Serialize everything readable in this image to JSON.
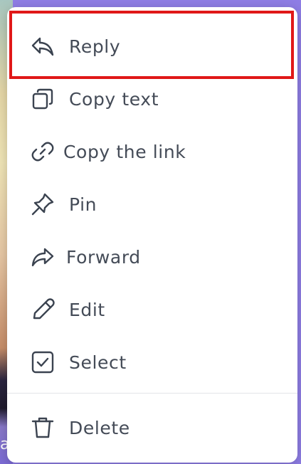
{
  "menu": {
    "items": [
      {
        "label": "Reply",
        "icon": "reply-icon"
      },
      {
        "label": "Copy text",
        "icon": "copy-icon"
      },
      {
        "label": "Copy the link",
        "icon": "link-icon"
      },
      {
        "label": "Pin",
        "icon": "pin-icon"
      },
      {
        "label": "Forward",
        "icon": "forward-icon"
      },
      {
        "label": "Edit",
        "icon": "pencil-icon"
      },
      {
        "label": "Select",
        "icon": "checkbox-icon"
      },
      {
        "label": "Delete",
        "icon": "trash-icon"
      }
    ],
    "highlight_color": "#e01818",
    "icon_color": "#3b4350",
    "text_color": "#444b57"
  },
  "background": {
    "accent_color": "#8f7ee6",
    "partial_letter": "a"
  }
}
